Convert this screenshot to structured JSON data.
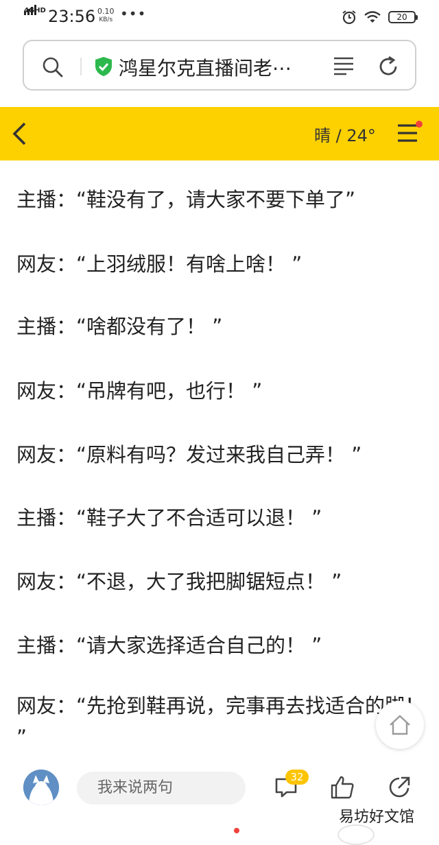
{
  "status_bar": {
    "network": "4GHD",
    "time": "23:56",
    "speed_value": "0.10",
    "speed_unit": "KB/s",
    "overflow": "•••",
    "battery": "20"
  },
  "browser": {
    "page_title": "鸿星尔克直播间老⋯"
  },
  "header": {
    "weather": "晴 / 24°"
  },
  "dialogue": [
    {
      "speaker": "主播：",
      "text": "“鞋没有了，请大家不要下单了”"
    },
    {
      "speaker": "网友：",
      "text": "“上羽绒服！有啥上啥！ ”"
    },
    {
      "speaker": "主播：",
      "text": "“啥都没有了！ ”"
    },
    {
      "speaker": "网友：",
      "text": "“吊牌有吧，也行！ ”"
    },
    {
      "speaker": "网友：",
      "text": "“原料有吗？发过来我自己弄！ ”"
    },
    {
      "speaker": "主播：",
      "text": "“鞋子大了不合适可以退！ ”"
    },
    {
      "speaker": "网友：",
      "text": "“不退，大了我把脚锯短点！ ”"
    },
    {
      "speaker": "主播：",
      "text": "“请大家选择适合自己的！ ”"
    },
    {
      "speaker": "网友：",
      "text": "“先抢到鞋再说，完事再去找适合的脚！ ”"
    }
  ],
  "bottom_bar": {
    "comment_placeholder": "我来说两句",
    "comment_count": "32",
    "watermark": "易坊好文馆"
  },
  "icons": {
    "search": "search-icon",
    "shield": "shield-check-icon",
    "list": "list-icon",
    "reload": "reload-icon",
    "back": "chevron-left-icon",
    "menu": "hamburger-menu-icon",
    "home": "home-icon",
    "comment": "comment-icon",
    "like": "thumbs-up-icon",
    "share": "share-icon",
    "alarm": "alarm-icon",
    "wifi": "wifi-icon"
  },
  "colors": {
    "header_yellow": "#fdd000",
    "badge_yellow": "#fdc400",
    "notice_red": "#f0413b",
    "shield_green": "#2db84d"
  }
}
